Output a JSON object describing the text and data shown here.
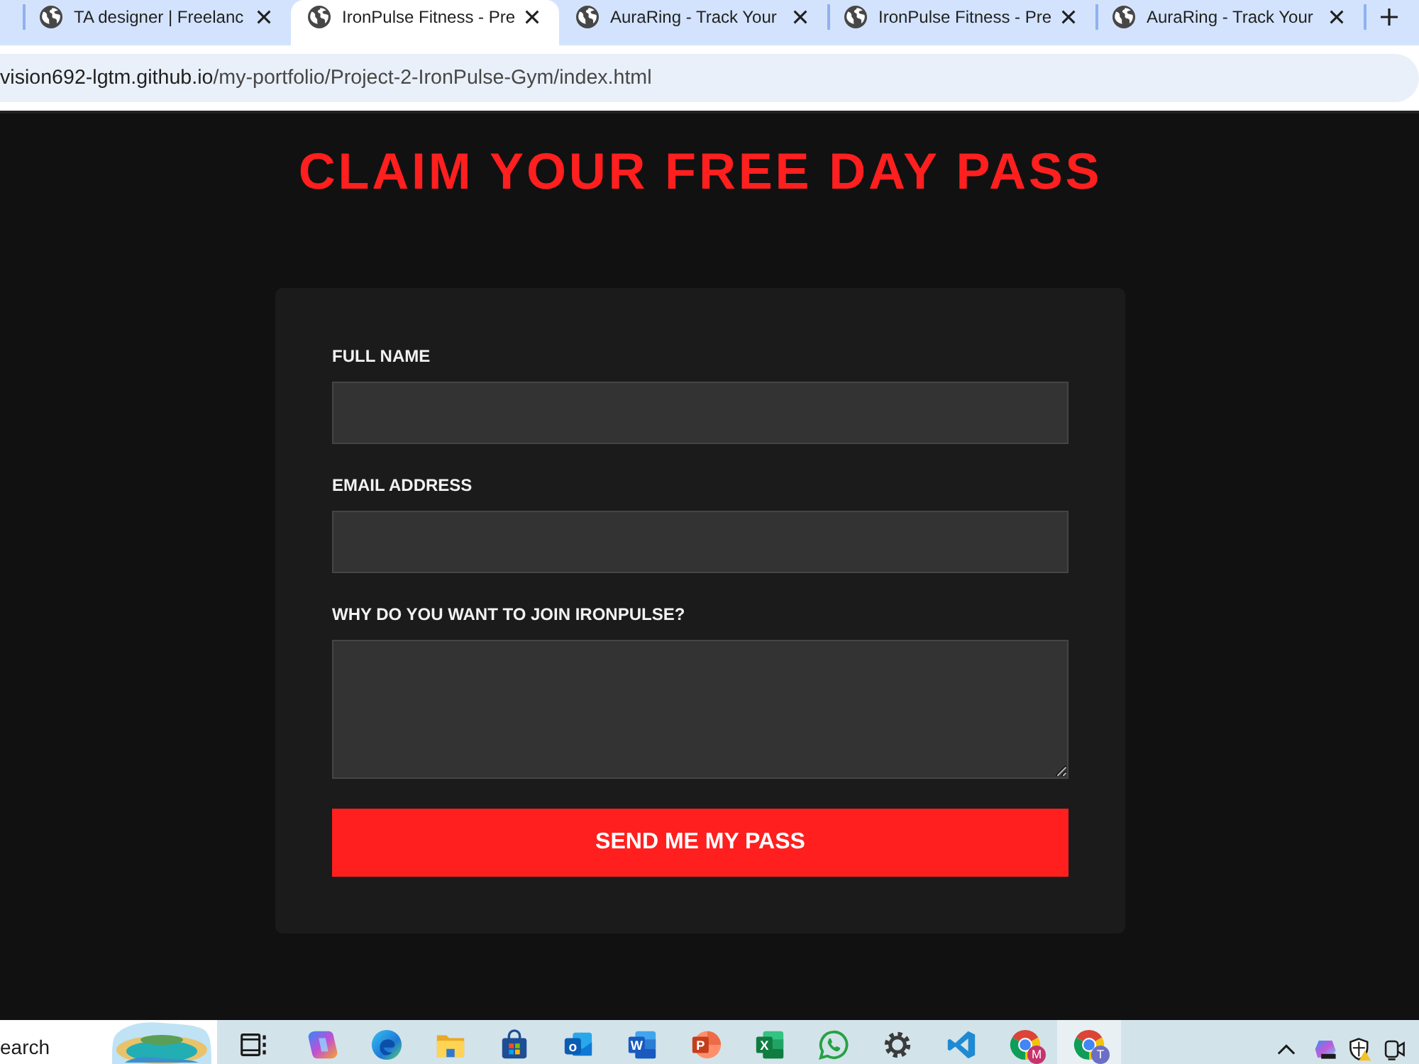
{
  "browser": {
    "tabs": [
      {
        "title": "TA designer | Freelanc",
        "selected": false
      },
      {
        "title": "IronPulse Fitness - Pre",
        "selected": true
      },
      {
        "title": "AuraRing - Track Your",
        "selected": false
      },
      {
        "title": "IronPulse Fitness - Pre",
        "selected": false
      },
      {
        "title": "AuraRing - Track Your",
        "selected": false
      }
    ],
    "url": {
      "host": "vision692-lgtm.github.io",
      "path": "/my-portfolio/Project-2-IronPulse-Gym/index.html"
    }
  },
  "page": {
    "heading": "CLAIM YOUR FREE DAY PASS",
    "fields": [
      {
        "label": "FULL NAME",
        "kind": "text"
      },
      {
        "label": "EMAIL ADDRESS",
        "kind": "text"
      },
      {
        "label": "WHY DO YOU WANT TO JOIN IRONPULSE?",
        "kind": "textarea"
      }
    ],
    "submit": "SEND ME MY PASS"
  },
  "taskbar": {
    "search": {
      "placeholder": "earch"
    },
    "apps": [
      {
        "kind": "taskview",
        "selected": false
      },
      {
        "kind": "swirl",
        "selected": false
      },
      {
        "kind": "wave",
        "selected": false
      },
      {
        "kind": "folder",
        "selected": false
      },
      {
        "kind": "bag",
        "selected": false
      },
      {
        "kind": "mail",
        "letter": "o",
        "selected": false
      },
      {
        "kind": "doc",
        "letter": "W",
        "selected": false
      },
      {
        "kind": "slides",
        "letter": "P",
        "selected": false
      },
      {
        "kind": "sheet",
        "letter": "X",
        "selected": false
      },
      {
        "kind": "chat",
        "selected": false
      },
      {
        "kind": "gear",
        "selected": false
      },
      {
        "kind": "ribbon",
        "selected": false
      },
      {
        "kind": "browser",
        "badge": {
          "letter": "M",
          "color": "#c4356e"
        },
        "selected": false
      },
      {
        "kind": "browser",
        "badge": {
          "letter": "T",
          "color": "#6b6fc6"
        },
        "selected": true
      }
    ]
  }
}
